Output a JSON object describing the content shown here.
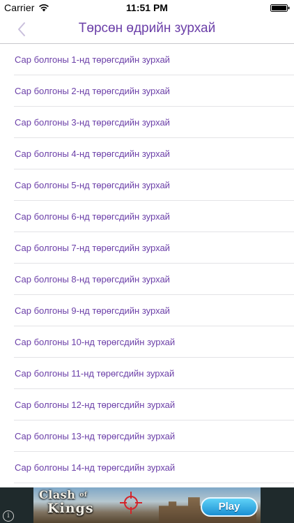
{
  "status_bar": {
    "carrier": "Carrier",
    "time": "11:51 PM"
  },
  "nav": {
    "title": "Төрсөн өдрийн зурхай",
    "back_icon": "chevron-left-icon"
  },
  "list": {
    "items": [
      {
        "label": "Сар болгоны 1-нд төрөгсдийн зурхай"
      },
      {
        "label": "Сар болгоны 2-нд төрөгсдийн зурхай"
      },
      {
        "label": "Сар болгоны 3-нд төрөгсдийн зурхай"
      },
      {
        "label": "Сар болгоны 4-нд төрөгсдийн зурхай"
      },
      {
        "label": "Сар болгоны 5-нд төрөгсдийн зурхай"
      },
      {
        "label": "Сар болгоны 6-нд төрөгсдийн зурхай"
      },
      {
        "label": "Сар болгоны 7-нд төрөгсдийн зурхай"
      },
      {
        "label": "Сар болгоны 8-нд төрөгсдийн зурхай"
      },
      {
        "label": "Сар болгоны 9-нд төрөгсдийн зурхай"
      },
      {
        "label": "Сар болгоны 10-нд төрөгсдийн зурхай"
      },
      {
        "label": "Сар болгоны 11-нд төрөгсдийн зурхай"
      },
      {
        "label": "Сар болгоны 12-нд төрөгсдийн зурхай"
      },
      {
        "label": "Сар болгоны 13-нд төрөгсдийн зурхай"
      },
      {
        "label": "Сар болгоны 14-нд төрөгсдийн зурхай"
      }
    ]
  },
  "ad": {
    "logo_line1": "Clash",
    "logo_of": "of",
    "logo_line2": "Kings",
    "play_label": "Play",
    "info_label": "i"
  },
  "colors": {
    "accent": "#6b3fa8",
    "separator": "#e3e3e6"
  }
}
